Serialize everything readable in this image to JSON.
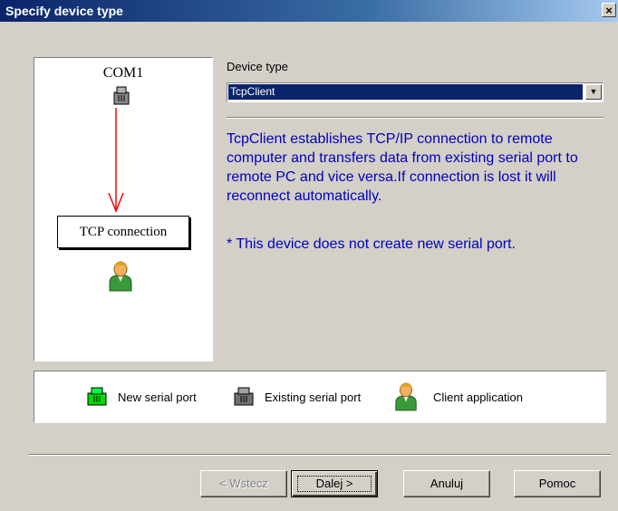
{
  "window": {
    "title": "Specify device type",
    "close_label": "×"
  },
  "diagram": {
    "port_label": "COM1",
    "connection_label": "TCP connection"
  },
  "form": {
    "device_type_label": "Device type",
    "device_type_value": "TcpClient",
    "description": "TcpClient establishes TCP/IP connection to remote computer and transfers data from existing serial port to remote PC and vice versa.If connection is lost it will reconnect automatically.",
    "note": "* This device does not create new serial port."
  },
  "legend": {
    "new_port": "New serial port",
    "existing_port": "Existing serial port",
    "client_app": "Client application"
  },
  "buttons": {
    "back": "< Wstecz",
    "next": "Dalej >",
    "cancel": "Anuluj",
    "help": "Pomoc"
  },
  "colors": {
    "arrow": "#ff0000",
    "description_text": "#0000c0",
    "selection": "#0a246a",
    "new_port_icon": "#00dd00",
    "existing_port_icon": "#707070"
  },
  "icons": {
    "port": "serial-port-icon",
    "client": "client-application-icon",
    "close": "close-icon"
  }
}
